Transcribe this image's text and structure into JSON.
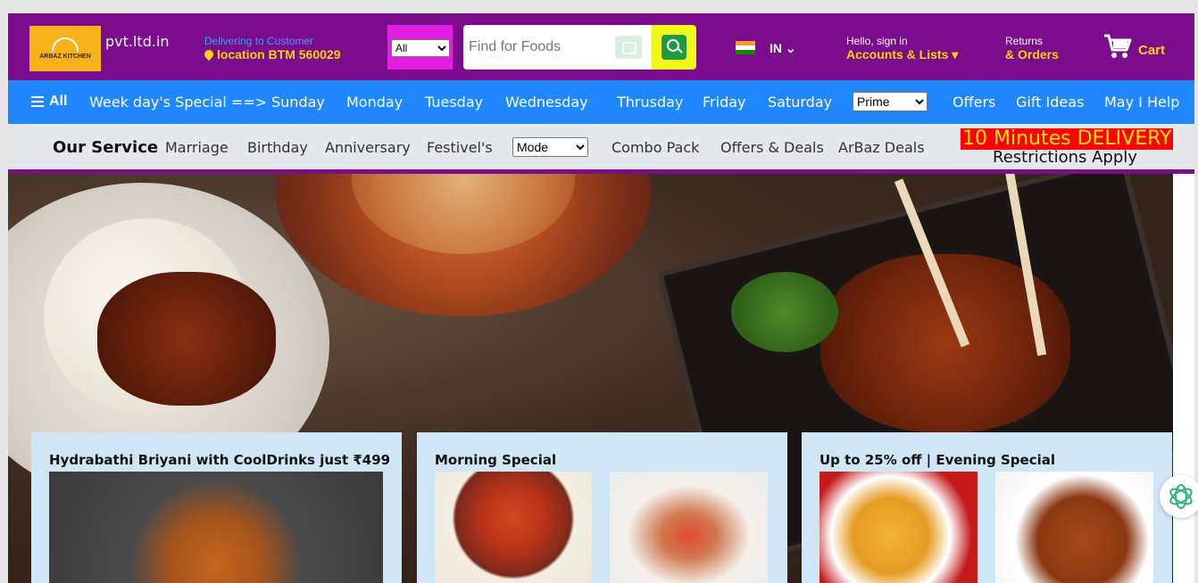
{
  "brand": {
    "logo_text": "ARBAZ KITCHEN",
    "domain": "pvt.ltd.in"
  },
  "delivery": {
    "line1": "Delivering to Customer",
    "line2": "location BTM 560029"
  },
  "search": {
    "category_selected": "All",
    "placeholder": "Find for Foods"
  },
  "language": {
    "code": "IN"
  },
  "account": {
    "line1": "Hello, sign in",
    "line2": "Accounts & Lists"
  },
  "returns": {
    "line1": "Returns",
    "line2": "& Orders"
  },
  "cart": {
    "label": "Cart"
  },
  "subnav": {
    "all": "All",
    "items": [
      "Week day's Special ==>",
      "Sunday",
      "Monday",
      "Tuesday",
      "Wednesday",
      "Thrusday",
      "Friday",
      "Saturday"
    ],
    "prime_selected": "Prime",
    "right_items": [
      "Offers",
      "Gift Ideas",
      "May I Help"
    ]
  },
  "service": {
    "title": "Our Service",
    "items": [
      "Marriage",
      "Birthday",
      "Anniversary",
      "Festivel's"
    ],
    "mode_selected": "Mode",
    "items2": [
      "Combo Pack",
      "Offers & Deals",
      "ArBaz Deals"
    ],
    "promo": "10 Minutes DELIVERY",
    "promo_note": "Restrictions Apply"
  },
  "cards": [
    {
      "title": "Hydrabathi Briyani with CoolDrinks just ₹499"
    },
    {
      "title": "Morning Special"
    },
    {
      "title": "Up to 25% off | Evening Special"
    }
  ],
  "colors": {
    "topnav": "#7b0c8c",
    "subnav": "#1f87ff",
    "accent_yellow": "#ffd400",
    "card_bg": "#cfe6f7"
  }
}
